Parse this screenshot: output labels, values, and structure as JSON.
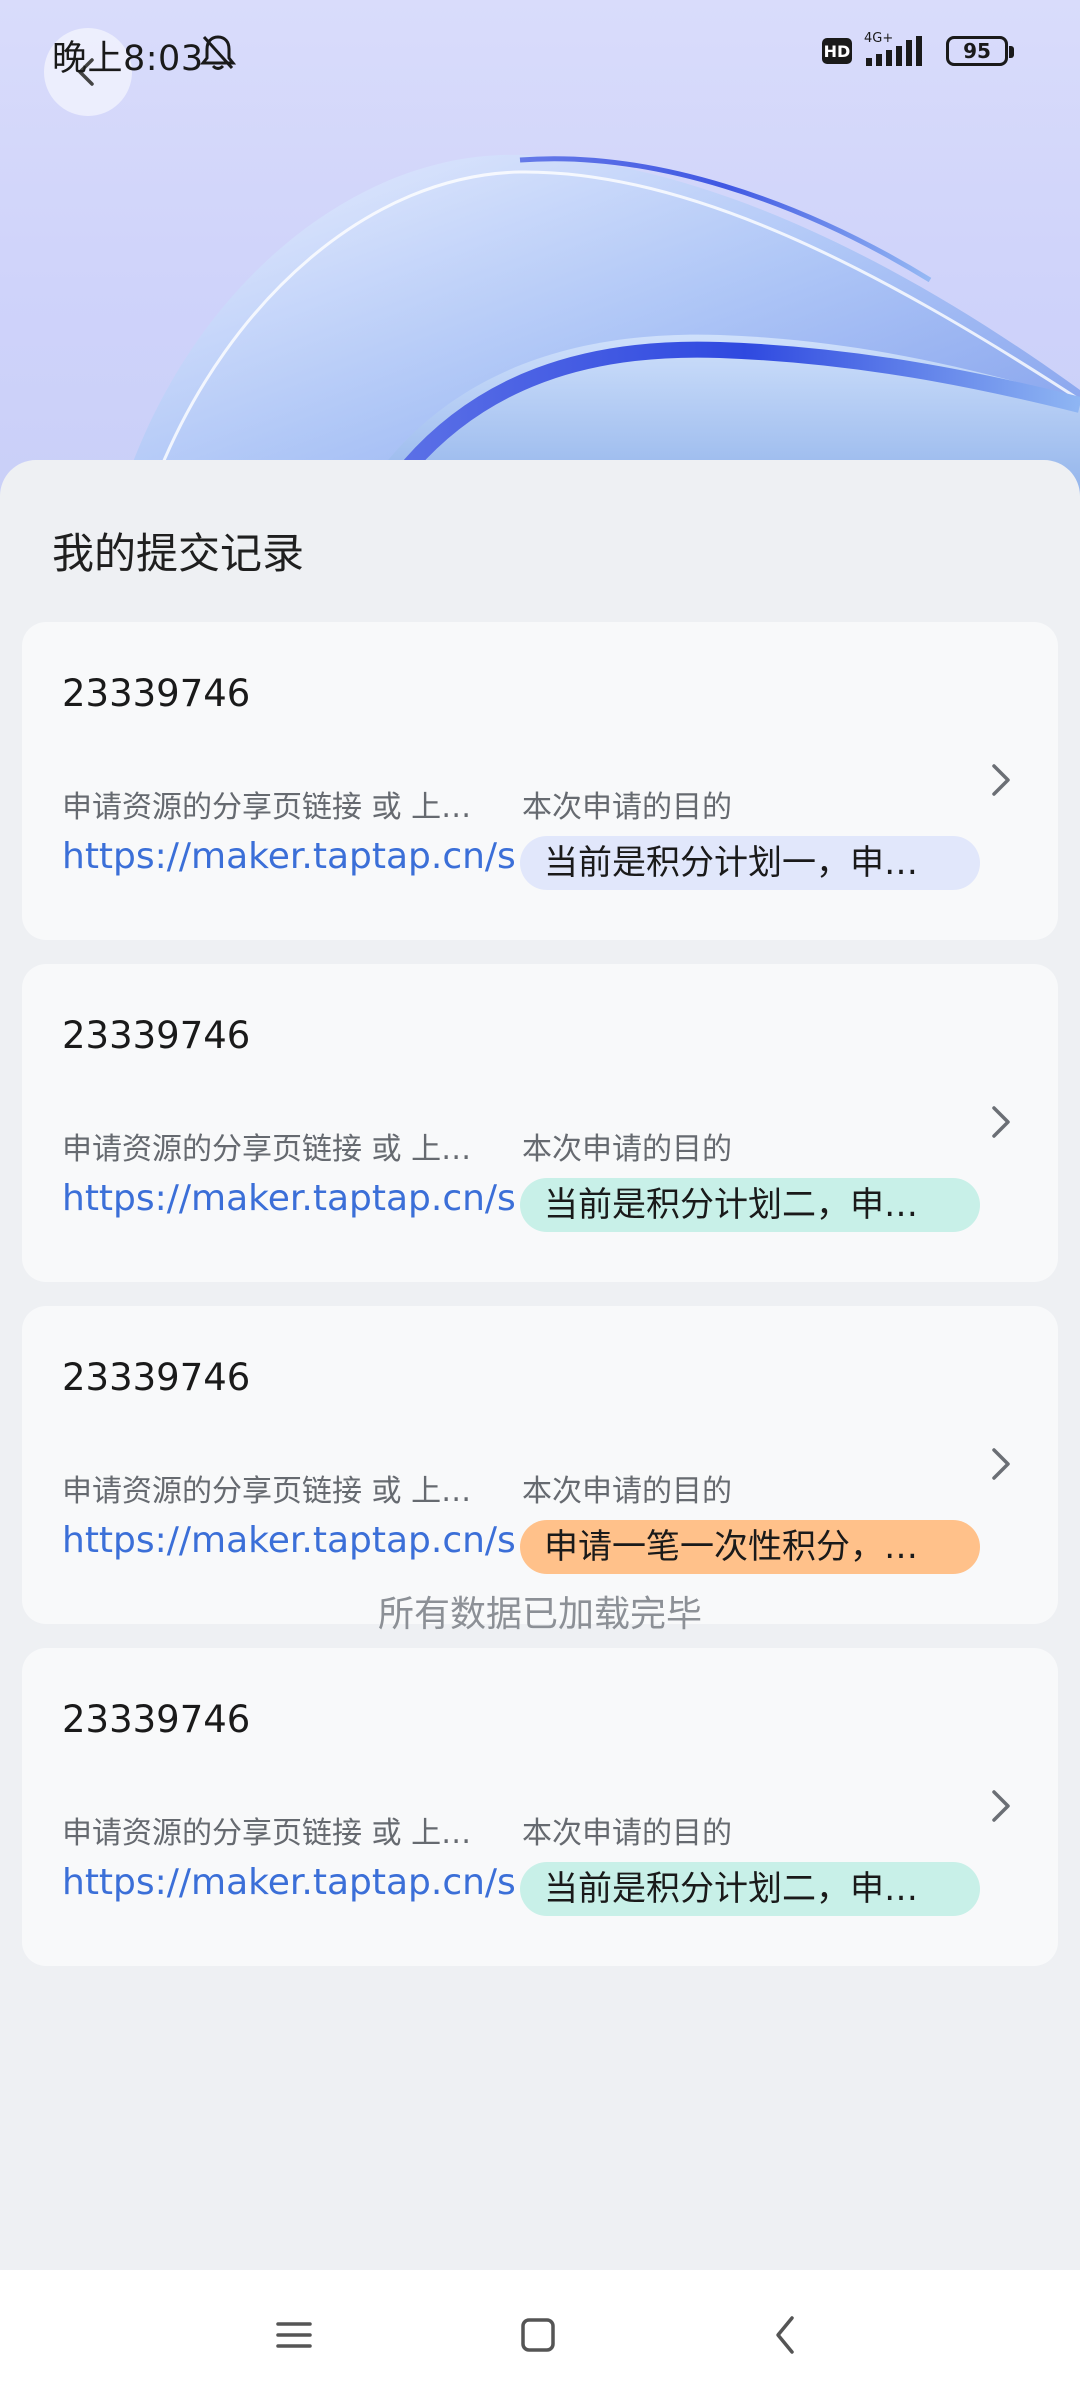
{
  "status_bar": {
    "time": "晚上8:03",
    "hd": "HD",
    "network": "4G+",
    "battery": "95"
  },
  "page": {
    "title": "我的提交记录",
    "end_text": "所有数据已加载完毕"
  },
  "records": [
    {
      "id": "23339746",
      "link_label": "申请资源的分享页链接 或 上…",
      "link_value": "https://maker.taptap.cn/s",
      "purpose_label": "本次申请的目的",
      "purpose_value": "当前是积分计划一，申…",
      "tag_color": "#e1e7fb"
    },
    {
      "id": "23339746",
      "link_label": "申请资源的分享页链接 或 上…",
      "link_value": "https://maker.taptap.cn/s",
      "purpose_label": "本次申请的目的",
      "purpose_value": "当前是积分计划二，申…",
      "tag_color": "#c8f0e8"
    },
    {
      "id": "23339746",
      "link_label": "申请资源的分享页链接 或 上…",
      "link_value": "https://maker.taptap.cn/s",
      "purpose_label": "本次申请的目的",
      "purpose_value": "申请一笔一次性积分，…",
      "tag_color": "#ffc18a"
    },
    {
      "id": "23339746",
      "link_label": "申请资源的分享页链接 或 上…",
      "link_value": "https://maker.taptap.cn/s",
      "purpose_label": "本次申请的目的",
      "purpose_value": "当前是积分计划二，申…",
      "tag_color": "#c8f0e8"
    }
  ],
  "icons": {
    "back": "back-arrow-icon",
    "bell": "bell-off-icon",
    "chevron": "chevron-right-icon",
    "nav_menu": "menu-icon",
    "nav_home": "home-square-icon",
    "nav_back": "back-triangle-icon"
  }
}
